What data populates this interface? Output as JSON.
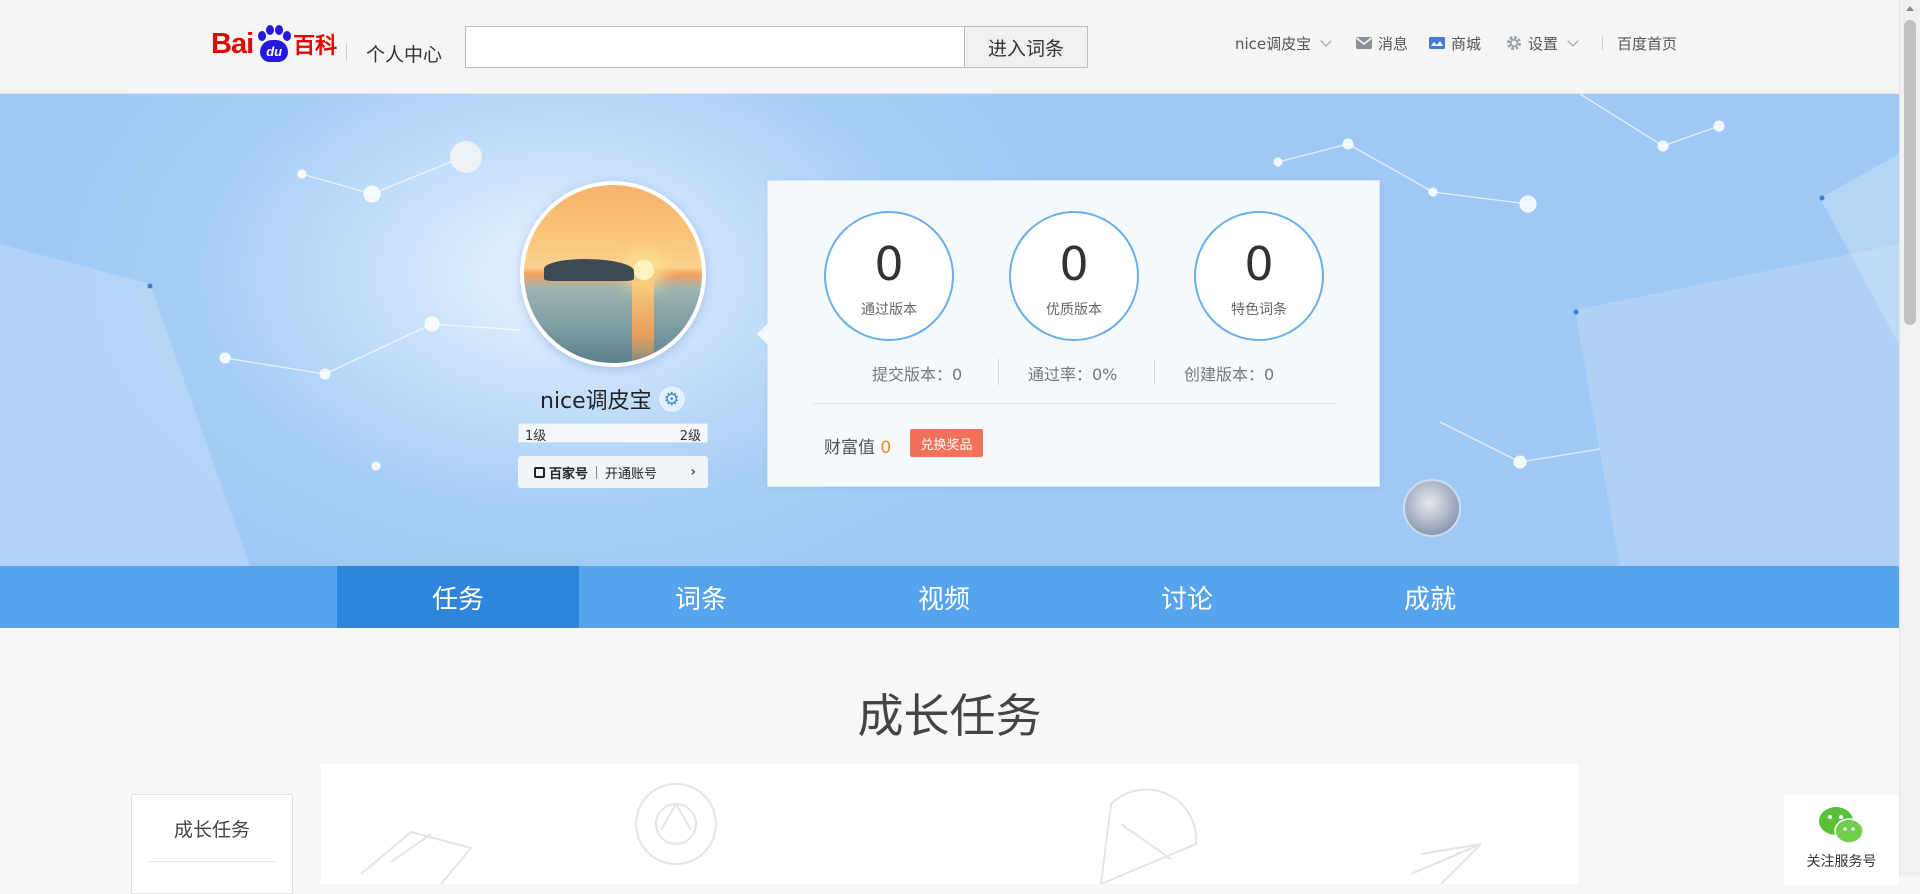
{
  "header": {
    "logo": {
      "bai": "Bai",
      "du": "du",
      "baike": "百科"
    },
    "center_label": "个人中心",
    "search": {
      "value": "",
      "placeholder": "",
      "button": "进入词条"
    },
    "user_menu": "nice调皮宝",
    "messages": "消息",
    "mall": "商城",
    "settings": "设置",
    "home": "百度首页"
  },
  "profile": {
    "username": "nice调皮宝",
    "level_current": "1级",
    "level_next": "2级",
    "baijiahao_brand": "百家号",
    "baijiahao_action": "开通账号",
    "arrow": "›"
  },
  "stats": {
    "circles": [
      {
        "value": "0",
        "label": "通过版本"
      },
      {
        "value": "0",
        "label": "优质版本"
      },
      {
        "value": "0",
        "label": "特色词条"
      }
    ],
    "submitted": "提交版本：0",
    "pass_rate": "通过率：0%",
    "created": "创建版本：0",
    "wealth_label": "财富值",
    "wealth_value": "0",
    "redeem_button": "兑换奖品"
  },
  "tabs": [
    {
      "label": "任务",
      "active": true
    },
    {
      "label": "词条",
      "active": false
    },
    {
      "label": "视频",
      "active": false
    },
    {
      "label": "讨论",
      "active": false
    },
    {
      "label": "成就",
      "active": false
    }
  ],
  "content": {
    "section_title": "成长任务",
    "left_nav": [
      "成长任务"
    ]
  },
  "wechat": {
    "label": "关注服务号"
  },
  "colors": {
    "brand_red": "#e10601",
    "brand_blue": "#2319dc",
    "tab_bar": "#56a3ee",
    "tab_active": "#2f84dc",
    "wealth": "#f08c2e",
    "redeem": "#f2715a",
    "circle_border": "#6aaeea"
  },
  "icons": [
    "mail-icon",
    "store-icon",
    "gear-icon",
    "chevron-down-icon",
    "verified-gear-icon",
    "wechat-icon"
  ]
}
